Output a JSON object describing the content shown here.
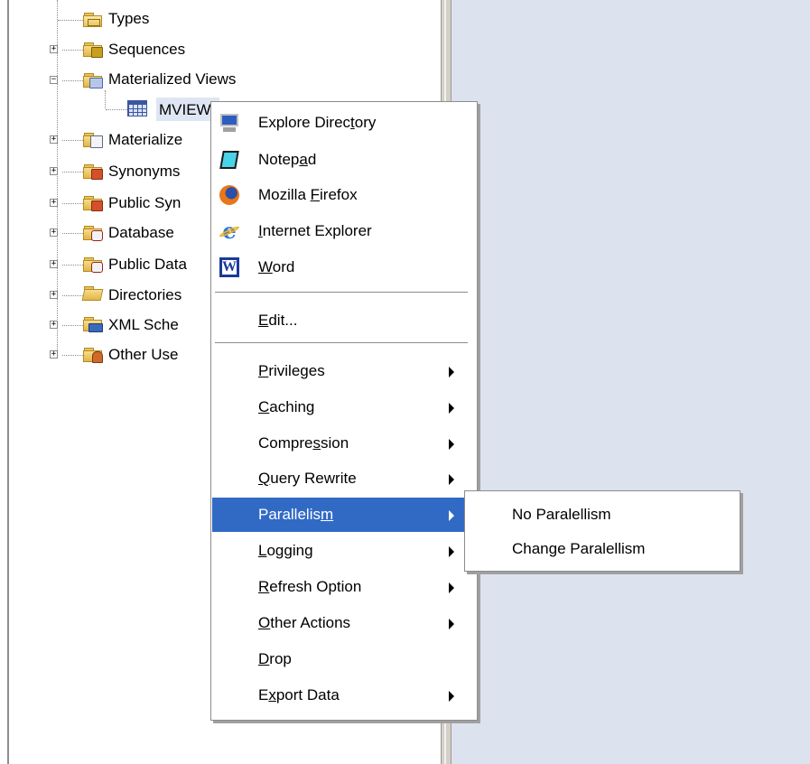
{
  "tree": {
    "items": [
      {
        "label": "Types",
        "expander": "",
        "icon": "types-icon"
      },
      {
        "label": "Sequences",
        "expander": "+",
        "icon": "sequences-icon"
      },
      {
        "label": "Materialized Views",
        "expander": "−",
        "icon": "materialized-views-icon"
      },
      {
        "label": "MVIEW",
        "expander": "",
        "icon": "mview-table-icon"
      },
      {
        "label": "Materialize",
        "expander": "+",
        "icon": "materialized-view-logs-icon"
      },
      {
        "label": "Synonyms",
        "expander": "+",
        "icon": "synonyms-icon"
      },
      {
        "label": "Public Syn",
        "expander": "+",
        "icon": "public-synonyms-icon"
      },
      {
        "label": "Database ",
        "expander": "+",
        "icon": "database-links-icon"
      },
      {
        "label": "Public Data",
        "expander": "+",
        "icon": "public-database-links-icon"
      },
      {
        "label": "Directories",
        "expander": "+",
        "icon": "directories-icon"
      },
      {
        "label": "XML Sche",
        "expander": "+",
        "icon": "xml-schemas-icon"
      },
      {
        "label": "Other Use",
        "expander": "+",
        "icon": "other-users-icon"
      }
    ]
  },
  "context_menu": {
    "external_tools": [
      {
        "pre": "Explore Direc",
        "key": "t",
        "post": "ory",
        "icon": "explore-directory-icon"
      },
      {
        "pre": "Notep",
        "key": "a",
        "post": "d",
        "icon": "notepad-icon"
      },
      {
        "pre": "Mozilla ",
        "key": "F",
        "post": "irefox",
        "icon": "firefox-icon"
      },
      {
        "pre": "",
        "key": "I",
        "post": "nternet Explorer",
        "icon": "internet-explorer-icon"
      },
      {
        "pre": "",
        "key": "W",
        "post": "ord",
        "icon": "word-icon"
      }
    ],
    "edit": {
      "pre": "",
      "key": "E",
      "post": "dit..."
    },
    "items": [
      {
        "pre": "",
        "key": "P",
        "post": "rivileges",
        "submenu": true
      },
      {
        "pre": "",
        "key": "C",
        "post": "aching",
        "submenu": true
      },
      {
        "pre": "Compre",
        "key": "s",
        "post": "sion",
        "submenu": true
      },
      {
        "pre": "",
        "key": "Q",
        "post": "uery Rewrite",
        "submenu": true
      },
      {
        "pre": "Parallelis",
        "key": "m",
        "post": "",
        "submenu": true,
        "selected": true
      },
      {
        "pre": "",
        "key": "L",
        "post": "ogging",
        "submenu": true
      },
      {
        "pre": "",
        "key": "R",
        "post": "efresh Option",
        "submenu": true
      },
      {
        "pre": "",
        "key": "O",
        "post": "ther Actions",
        "submenu": true
      },
      {
        "pre": "",
        "key": "D",
        "post": "rop",
        "submenu": false
      },
      {
        "pre": "E",
        "key": "x",
        "post": "port Data",
        "submenu": true
      }
    ]
  },
  "submenu": {
    "items": [
      {
        "label": "No Paralellism"
      },
      {
        "label": "Change Paralellism"
      }
    ]
  },
  "colors": {
    "selection": "#316ac5",
    "right_panel": "#dde3ee",
    "folder": "#e8c35a"
  }
}
